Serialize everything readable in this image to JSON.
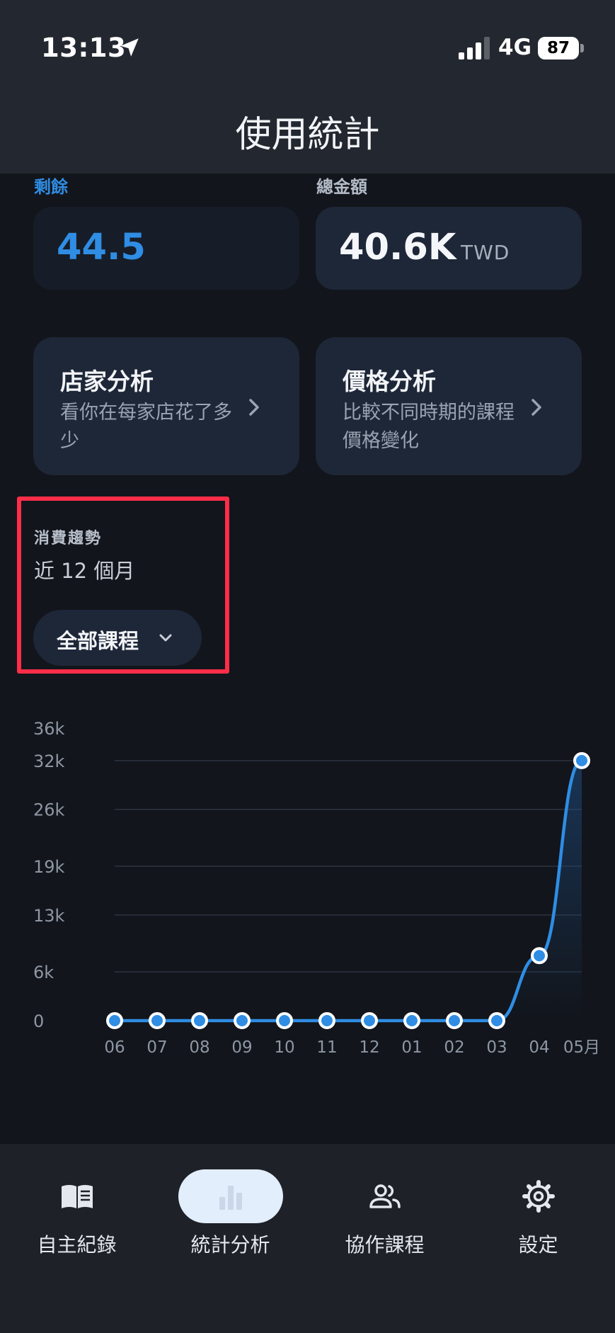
{
  "status_bar": {
    "time": "13:13",
    "network": "4G",
    "battery": "87",
    "icons": [
      "location-arrow-icon",
      "signal-bars-icon",
      "battery-icon"
    ]
  },
  "header": {
    "title": "使用統計"
  },
  "stats": {
    "remaining": {
      "label": "剩餘",
      "value": "44.5"
    },
    "total": {
      "label": "總金額",
      "value": "40.6K",
      "unit": "TWD"
    }
  },
  "analysis_cards": [
    {
      "title": "店家分析",
      "description": "看你在每家店花了多少",
      "icon": "chevron-right-icon"
    },
    {
      "title": "價格分析",
      "description": "比較不同時期的課程價格變化",
      "icon": "chevron-right-icon"
    }
  ],
  "trend": {
    "label": "消費趨勢",
    "period": "近 12 個月",
    "filter": {
      "label": "全部課程",
      "icon": "chevron-down-icon"
    }
  },
  "chart_data": {
    "type": "line",
    "categories": [
      "06",
      "07",
      "08",
      "09",
      "10",
      "11",
      "12",
      "01",
      "02",
      "03",
      "04",
      "05月"
    ],
    "series": [
      {
        "values": [
          0,
          0,
          0,
          0,
          0,
          0,
          0,
          0,
          0,
          0,
          8000,
          32000
        ]
      }
    ],
    "y_ticks": [
      "0",
      "6k",
      "13k",
      "19k",
      "26k",
      "32k",
      "36k"
    ],
    "ylim": [
      0,
      36000
    ],
    "grid": true,
    "title": "",
    "xlabel": "",
    "ylabel": "",
    "colors": {
      "line": "#2f8de4",
      "grid": "#2c3340",
      "tick_text": "#8e97a4"
    }
  },
  "tabbar": {
    "tabs": [
      {
        "label": "自主紀錄",
        "icon": "open-book-icon",
        "active": false
      },
      {
        "label": "統計分析",
        "icon": "bar-chart-icon",
        "active": true
      },
      {
        "label": "協作課程",
        "icon": "people-icon",
        "active": false
      },
      {
        "label": "設定",
        "icon": "gear-icon",
        "active": false
      }
    ]
  },
  "colors": {
    "background": "#12151b",
    "header": "#232830",
    "card": "#1e2738",
    "accent": "#2f8de4",
    "highlight_border": "#ff2d49"
  }
}
